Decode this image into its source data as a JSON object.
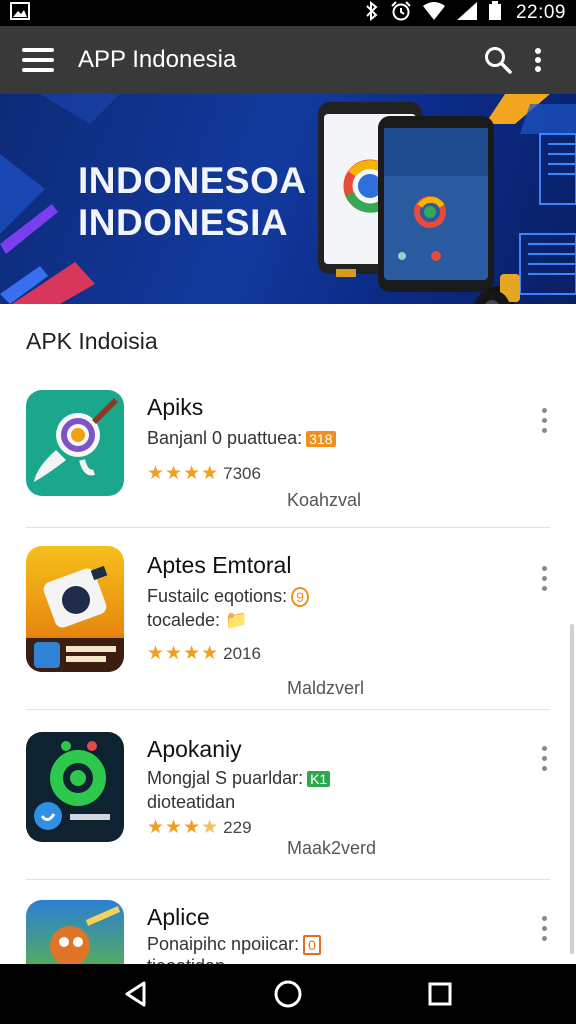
{
  "status_bar": {
    "time": "22:09",
    "icons": [
      "image-icon",
      "bluetooth-icon",
      "alarm-icon",
      "wifi-icon",
      "signal-icon",
      "battery-icon"
    ]
  },
  "app_bar": {
    "title": "APP Indonesia",
    "icons": [
      "menu-icon",
      "search-icon",
      "overflow-menu-icon"
    ]
  },
  "banner": {
    "line1": "INDONESOA",
    "line2": "INDONESIA"
  },
  "section": {
    "title": "APK Indoisia"
  },
  "apps": [
    {
      "name": "Apiks",
      "desc": "Banjanl 0 puattuea:",
      "desc2": "",
      "badge": "318",
      "badge_color": "#f09020",
      "rating": 4,
      "rating_text": "7306",
      "meta": "Koahzval"
    },
    {
      "name": "Aptes Emtoral",
      "desc": "Fustailc eqotions:",
      "desc2": "tocalede:",
      "badge": "9",
      "badge_color": "#f09020",
      "rating": 4,
      "rating_text": "2016",
      "meta": "Maldzverl"
    },
    {
      "name": "Apokaniy",
      "desc": "Mongjal S puarldar:",
      "desc2": "dioteatidan",
      "badge": "K1",
      "badge_color": "#2ea84a",
      "rating": 3.5,
      "rating_text": "229",
      "meta": "Maak2verd"
    },
    {
      "name": "Aplice",
      "desc": "Ponaipihc npoiicar:",
      "desc2": "tieoatidan",
      "badge": "0",
      "badge_color": "#e07020",
      "rating": 0,
      "rating_text": "",
      "meta": ""
    }
  ],
  "colors": {
    "app_bar": "#393939",
    "status_bar": "#000000",
    "banner": "#123a9e",
    "star": "#f0a020"
  },
  "nav_bar": {
    "icons": [
      "back-icon",
      "home-icon",
      "recents-icon"
    ]
  }
}
